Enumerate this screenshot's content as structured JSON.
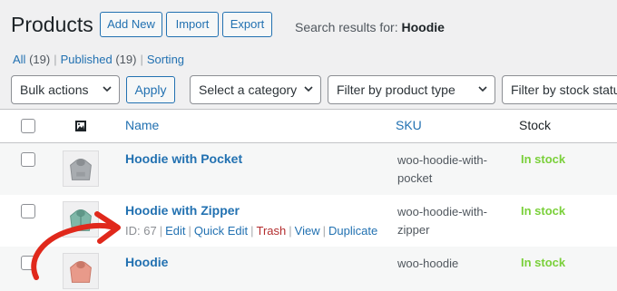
{
  "header": {
    "title": "Products",
    "add_new_label": "Add New",
    "import_label": "Import",
    "export_label": "Export",
    "search_prefix": "Search results for: ",
    "search_term": "Hoodie"
  },
  "subsubsub": {
    "all_label": "All",
    "all_count": "(19)",
    "published_label": "Published",
    "published_count": "(19)",
    "sorting_label": "Sorting",
    "separator": "|"
  },
  "filters": {
    "bulk_actions": "Bulk actions",
    "apply_label": "Apply",
    "category": "Select a category",
    "product_type": "Filter by product type",
    "stock_status": "Filter by stock status"
  },
  "table": {
    "columns": {
      "image_icon": "image-icon",
      "name": "Name",
      "sku": "SKU",
      "stock": "Stock"
    },
    "rows": [
      {
        "name": "Hoodie with Pocket",
        "sku_line1": "woo-hoodie-with-",
        "sku_line2": "pocket",
        "stock": "In stock",
        "thumb_color": "#a8acb0"
      },
      {
        "name": "Hoodie with Zipper",
        "sku_line1": "woo-hoodie-with-",
        "sku_line2": "zipper",
        "stock": "In stock",
        "thumb_color": "#7fb7a8",
        "actions": {
          "id_text": "ID: 67",
          "edit": "Edit",
          "quick_edit": "Quick Edit",
          "trash": "Trash",
          "view": "View",
          "duplicate": "Duplicate",
          "separator": "|"
        }
      },
      {
        "name": "Hoodie",
        "sku_line1": "woo-hoodie",
        "sku_line2": "",
        "stock": "In stock",
        "thumb_color": "#e89a8a"
      }
    ]
  },
  "colors": {
    "link": "#2271b1",
    "in_stock": "#7ad03a",
    "trash": "#b32d2e",
    "arrow": "#e0281b"
  }
}
